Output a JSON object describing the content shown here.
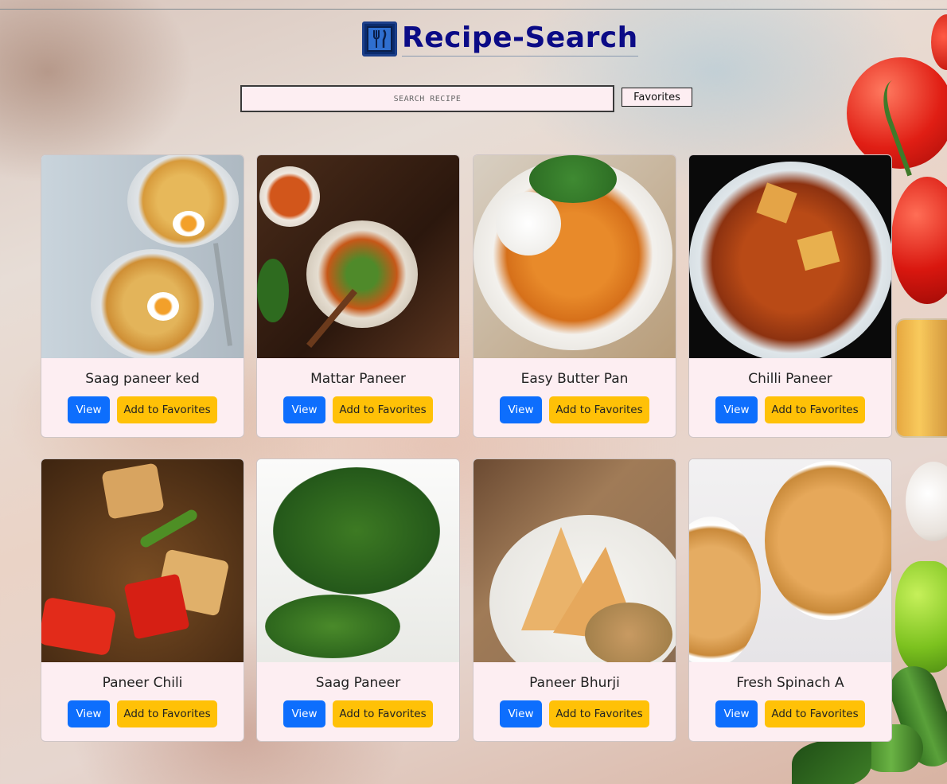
{
  "header": {
    "title": "Recipe-Search",
    "logo_icon": "utensils-icon"
  },
  "search": {
    "placeholder": "SEARCH RECIPE",
    "value": ""
  },
  "nav": {
    "favorites_label": "Favorites"
  },
  "buttons": {
    "view_label": "View",
    "favorite_label": "Add to Favorites"
  },
  "colors": {
    "title": "#0b0b86",
    "view_button": "#0d6efd",
    "favorite_button": "#ffc107",
    "card_background": "#fdeef2"
  },
  "recipes": [
    {
      "title": "Saag paneer ked",
      "image": "egg-noodle-bowls-photo"
    },
    {
      "title": "Mattar Paneer",
      "image": "mattar-paneer-pot-photo"
    },
    {
      "title": "Easy Butter Pan",
      "image": "butter-paneer-rice-plate-photo"
    },
    {
      "title": "Chilli Paneer",
      "image": "chilli-paneer-bowl-photo"
    },
    {
      "title": "Paneer Chili",
      "image": "paneer-chili-closeup-photo"
    },
    {
      "title": "Saag Paneer",
      "image": "spinach-leaves-photo"
    },
    {
      "title": "Paneer Bhurji",
      "image": "paneer-bhurji-naan-photo"
    },
    {
      "title": "Fresh Spinach A",
      "image": "spinach-souffle-ramekins-photo"
    }
  ]
}
